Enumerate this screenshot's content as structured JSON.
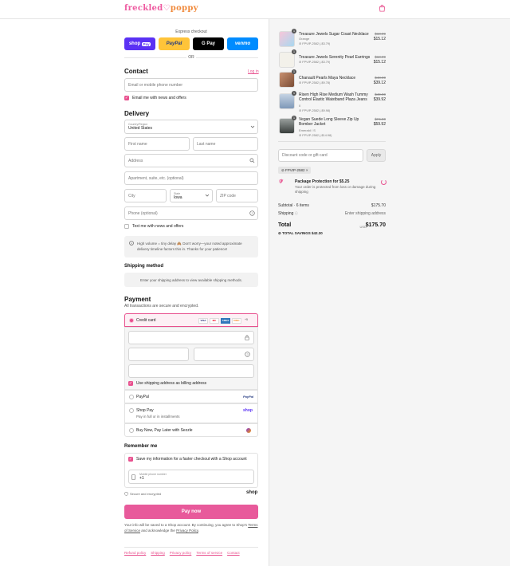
{
  "brand": {
    "part1": "freckled",
    "heart": "♡",
    "part2": "poppy"
  },
  "express": {
    "label": "Express checkout",
    "shop": "shop",
    "shop_pay": "Pay",
    "paypal": "PayPal",
    "gpay": "G Pay",
    "venmo": "venmo",
    "or": "OR"
  },
  "contact": {
    "title": "Contact",
    "login": "Log in",
    "email_placeholder": "Email or mobile phone number",
    "email_news": "Email me with news and offers"
  },
  "delivery": {
    "title": "Delivery",
    "country_label": "Country/Region",
    "country_value": "United States",
    "first_name": "First name",
    "last_name": "Last name",
    "address": "Address",
    "apartment": "Apartment, suite, etc. (optional)",
    "city": "City",
    "state_label": "State",
    "state_value": "Iowa",
    "zip": "ZIP code",
    "phone": "Phone (optional)",
    "text_news": "Text me with news and offers",
    "notice": "High volume = tiny delay 🙈 Don't worry—your noted approximate delivery timeline factors this in. Thanks for your patience!"
  },
  "shipping": {
    "title": "Shipping method",
    "placeholder": "Enter your shipping address to view available shipping methods."
  },
  "payment": {
    "title": "Payment",
    "subtitle": "All transactions are secure and encrypted.",
    "credit_card": "Credit card",
    "card_brands": [
      "VISA",
      "MC",
      "AMEX",
      "DISC",
      "+5"
    ],
    "billing_same": "Use shipping address as billing address",
    "paypal": "PayPal",
    "paypal_logo": "PayPal",
    "shop_pay": "Shop Pay",
    "shop_pay_sub": "Pay in full or in installments",
    "shop_logo": "shop",
    "sezzle": "Buy Now, Pay Later with Sezzle"
  },
  "remember": {
    "title": "Remember me",
    "save_info": "Save my information for a faster checkout with a Shop account",
    "mobile_label": "Mobile phone number",
    "mobile_value": "+1",
    "secure": "Secure and encrypted",
    "shop_logo": "shop"
  },
  "pay_now": "Pay now",
  "legal": {
    "text1": "Your info will be saved to a Shop account. By continuing, you agree to Shop's",
    "tos": "Terms of Service",
    "text2": "and acknowledge the",
    "privacy": "Privacy Policy"
  },
  "footer_links": [
    "Refund policy",
    "Shipping",
    "Privacy policy",
    "Terms of service",
    "Contact"
  ],
  "products": [
    {
      "qty": "1",
      "name": "Treasure Jewels Sugar Coast Necklace",
      "variant": "Orange",
      "discount": "FPVIP-2582 (-$3.79)",
      "old": "$18.99",
      "new": "$15.12"
    },
    {
      "qty": "1",
      "name": "Treasure Jewels Serenity Pearl Earrings",
      "variant": "",
      "discount": "FPVIP-2582 (-$3.79)",
      "old": "$18.99",
      "new": "$15.12"
    },
    {
      "qty": "1",
      "name": "Chanault Pearls Maya Necklace",
      "variant": "",
      "discount": "FPVIP-2582 (-$9.78)",
      "old": "$48.90",
      "new": "$39.12"
    },
    {
      "qty": "1",
      "name": "Risen High Rise Medium Wash Tummy Control Elastic Waistband Plaza Jeans",
      "variant": "0",
      "discount": "FPVIP-2582 (-$9.98)",
      "old": "$49.90",
      "new": "$39.92"
    },
    {
      "qty": "1",
      "name": "Vegan Suede Long Sleeve Zip Up Bomber Jacket",
      "variant": "Emerald / S",
      "discount": "FPVIP-2582 (-$14.98)",
      "old": "$74.90",
      "new": "$59.92"
    }
  ],
  "discount": {
    "placeholder": "Discount code or gift card",
    "apply": "Apply",
    "code": "FPVIP-2582"
  },
  "protection": {
    "title": "Package Protection for $5.25",
    "desc": "Your order is protected from loss or damage during shipping"
  },
  "summary": {
    "subtotal_label": "Subtotal · 6 items",
    "subtotal": "$175.70",
    "shipping_label": "Shipping",
    "shipping_value": "Enter shipping address",
    "total_label": "Total",
    "currency": "USD",
    "total": "$175.70",
    "savings_label": "TOTAL SAVINGS",
    "savings": "$42.30"
  }
}
